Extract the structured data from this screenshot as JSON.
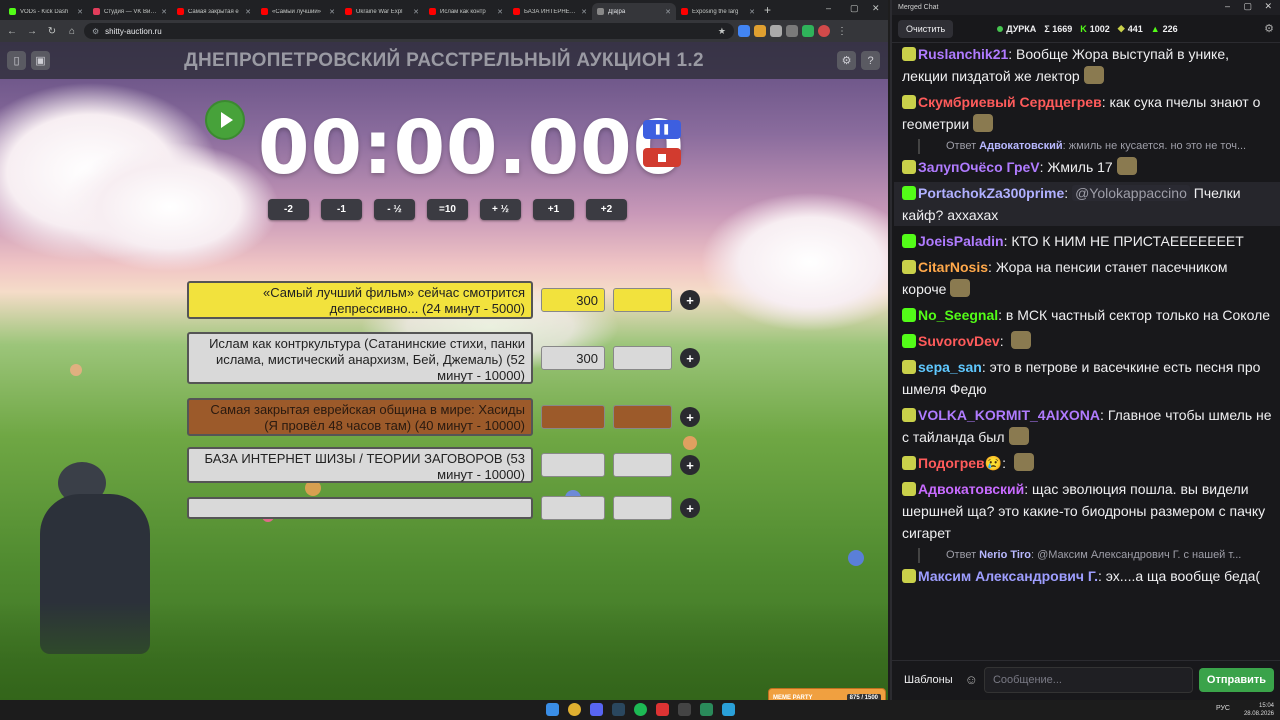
{
  "browser": {
    "tabs": [
      {
        "label": "VODs - Kick Dash",
        "color": "#53fc18"
      },
      {
        "label": "Студия — VK Видео",
        "color": "#e23d5b"
      },
      {
        "label": "Самая закрытая е",
        "color": "#ff0000"
      },
      {
        "label": "«Самый лучший»",
        "color": "#ff0000"
      },
      {
        "label": "Ukraine War Expl",
        "color": "#ff0000"
      },
      {
        "label": "Ислам как контр",
        "color": "#ff0000"
      },
      {
        "label": "БАЗА ИНТЕРНЕТ Ш",
        "color": "#ff0000"
      },
      {
        "label": "Д|а|ра",
        "color": "#888888",
        "active": true
      },
      {
        "label": "Exposing the larg",
        "color": "#ff0000"
      }
    ],
    "url": "shitty-auction.ru"
  },
  "auction": {
    "title": "ДНЕПРОПЕТРОВСКИЙ РАССТРЕЛЬНЫЙ АУКЦИОН 1.2",
    "timer": "00:00.000",
    "time_buttons": [
      "-2",
      "-1",
      "- ½",
      "=10",
      "+ ½",
      "+1",
      "+2"
    ],
    "lots": [
      {
        "name": "«Самый лучший фильм» сейчас смотрится депрессивно... (24 минут - 5000)",
        "amount": "300",
        "color": "#f2e23d"
      },
      {
        "name": "Ислам как контркультура (Сатанинские стихи, панки ислама, мистический анархизм,  Бей, Джемаль) (52 минут - 10000)",
        "amount": "300",
        "color": "#d9d9d9"
      },
      {
        "name": "Самая закрытая еврейская община в мире: Хасиды (Я провёл 48 часов там) (40 минут - 10000)",
        "amount": "",
        "color": "#9c5a2a"
      },
      {
        "name": "БАЗА ИНТЕРНЕТ ШИЗЫ / ТЕОРИИ ЗАГОВОРОВ (53 минут - 10000)",
        "amount": "",
        "color": "#d9d9d9"
      },
      {
        "name": "",
        "amount": "",
        "color": "#d9d9d9"
      }
    ]
  },
  "chat": {
    "window_title": "Merged Chat",
    "clear_label": "Очистить",
    "channel": "ДУРКА",
    "stat_total": "Σ 1669",
    "stat_kick": "1002",
    "stat_twitch": "441",
    "stat_other": "226",
    "messages": [
      {
        "user": "Ruslanchik21",
        "color": "#b07bff",
        "badge": "twitch",
        "text": "Вообще Жора выступай в унике, лекции пиздатой же лектор",
        "emote": true
      },
      {
        "user": "Скумбриевый Сердцегрев",
        "color": "#ff5b5b",
        "badge": "twitch",
        "text": "как сука пчелы знают о геометрии",
        "emote": true
      },
      {
        "reply_user": "Адвокатовский",
        "reply_text": "жмиль не кусается. но это не точ...",
        "reply_prefix": "Ответ"
      },
      {
        "user": "ЗалупОчёсо ГреV",
        "color": "#b07bff",
        "badge": "twitch",
        "text": "Жмиль 17",
        "emote": true
      },
      {
        "user": "PortachokZa300prime",
        "color": "#b0b0ff",
        "badge": "kick",
        "mention": "@Yolokappaccino",
        "text": "Пчелки кайф? аххахах",
        "highlight": true
      },
      {
        "user": "JoeisPaladin",
        "color": "#b07bff",
        "badge": "kick",
        "text": "КТО К НИМ НЕ ПРИСТАЕЕЕЕЕЕЕТ"
      },
      {
        "user": "CitarNosis",
        "color": "#ffa84a",
        "badge": "twitch",
        "text": "Жора на пенсии станет пасечником короче",
        "emote": true
      },
      {
        "user": "No_Seegnal",
        "color": "#53fc18",
        "badge": "kick",
        "text": "в МСК частный сектор только на Соколе"
      },
      {
        "user": "SuvorovDev",
        "color": "#ff5b5b",
        "badge": "kick",
        "text": "",
        "emote": true
      },
      {
        "user": "sepa_san",
        "color": "#5fc8ff",
        "badge": "twitch",
        "text": "это в петрове и васечкине есть песня про шмеля Федю"
      },
      {
        "user": "VOLKA_KORMIT_4AIXONA",
        "color": "#b07bff",
        "badge": "twitch",
        "text": "Главное чтобы шмель не с тайланда был",
        "emote": true
      },
      {
        "user": "Подогрев😢",
        "color": "#ff5b5b",
        "badge": "twitch",
        "text": "",
        "emote": true
      },
      {
        "user": "Адвокатовский",
        "color": "#c86bff",
        "badge": "twitch",
        "text": "щас эволюция пошла. вы видели шершней ща? это какие-то биодроны размером с пачку сигарет"
      },
      {
        "reply_user": "Nerio Tiro",
        "reply_text": "@Максим Александрович Г.  с нашей т...",
        "reply_prefix": "Ответ"
      },
      {
        "user": "Максим Александрович Г.",
        "color": "#9e9eff",
        "badge": "twitch",
        "text": "эх....а ща вообще беда("
      }
    ],
    "templates_label": "Шаблоны",
    "input_placeholder": "Сообщение...",
    "send_label": "Отправить"
  },
  "taskbar": {
    "lang": "РУС",
    "time": "15:04",
    "date": "28.08.2026"
  },
  "overlay": {
    "label": "MEME PARTY",
    "progress": "875 / 1500"
  }
}
